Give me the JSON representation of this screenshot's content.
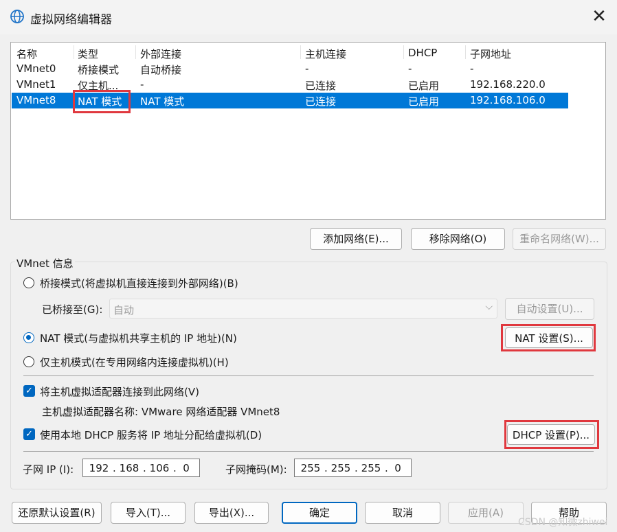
{
  "window": {
    "title": "虚拟网络编辑器",
    "close_glyph": "✕"
  },
  "network_list": {
    "columns": [
      "名称",
      "类型",
      "外部连接",
      "主机连接",
      "DHCP",
      "子网地址"
    ],
    "rows": [
      {
        "name": "VMnet0",
        "type": "桥接模式",
        "external": "自动桥接",
        "host": "-",
        "dhcp": "-",
        "subnet": "-",
        "selected": false
      },
      {
        "name": "VMnet1",
        "type": "仅主机...",
        "external": "-",
        "host": "已连接",
        "dhcp": "已启用",
        "subnet": "192.168.220.0",
        "selected": false
      },
      {
        "name": "VMnet8",
        "type": "NAT 模式",
        "external": "NAT 模式",
        "host": "已连接",
        "dhcp": "已启用",
        "subnet": "192.168.106.0",
        "selected": true
      }
    ]
  },
  "list_buttons": {
    "add": "添加网络(E)...",
    "remove": "移除网络(O)",
    "rename": "重命名网络(W)..."
  },
  "vmnet_info": {
    "group_label": "VMnet 信息",
    "bridged_label": "桥接模式(将虚拟机直接连接到外部网络)(B)",
    "bridged_to_label": "已桥接至(G):",
    "bridged_to_value": "自动",
    "auto_settings": "自动设置(U)...",
    "nat_label": "NAT 模式(与虚拟机共享主机的 IP 地址)(N)",
    "nat_settings": "NAT 设置(S)...",
    "hostonly_label": "仅主机模式(在专用网络内连接虚拟机)(H)",
    "connect_adapter_label": "将主机虚拟适配器连接到此网络(V)",
    "adapter_name": "主机虚拟适配器名称: VMware 网络适配器 VMnet8",
    "dhcp_label": "使用本地 DHCP 服务将 IP 地址分配给虚拟机(D)",
    "dhcp_settings": "DHCP 设置(P)...",
    "subnet_ip_label": "子网 IP (I):",
    "subnet_ip": [
      "192",
      "168",
      "106",
      "0"
    ],
    "subnet_mask_label": "子网掩码(M):",
    "subnet_mask": [
      "255",
      "255",
      "255",
      "0"
    ],
    "selected_mode": "nat",
    "connect_adapter_checked": true,
    "dhcp_checked": true
  },
  "footer_buttons": {
    "restore": "还原默认设置(R)",
    "import": "导入(T)...",
    "export": "导出(X)...",
    "ok": "确定",
    "cancel": "取消",
    "apply": "应用(A)",
    "help": "帮助"
  },
  "watermark": "CSDN @知微zhiwei",
  "colors": {
    "selection": "#0078d7",
    "highlight_box": "#e0383e",
    "accent": "#0067c0"
  }
}
